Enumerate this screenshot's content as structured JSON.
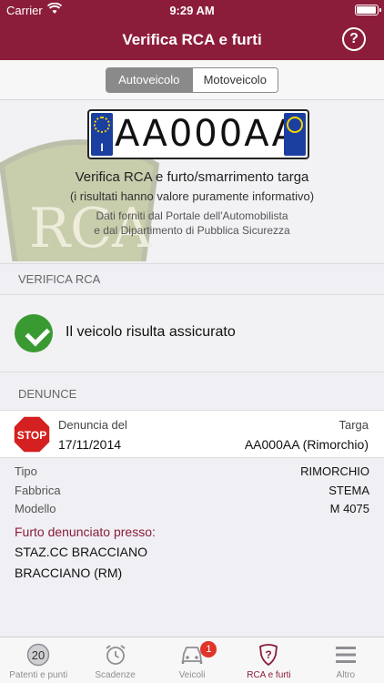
{
  "status_bar": {
    "carrier": "Carrier",
    "time": "9:29 AM"
  },
  "nav": {
    "title": "Verifica RCA e furti"
  },
  "segments": [
    {
      "label": "Autoveicolo",
      "selected": true
    },
    {
      "label": "Motoveicolo",
      "selected": false
    }
  ],
  "plate": {
    "number": "AA000AA",
    "country_letter": "I"
  },
  "shield_text": "RCA",
  "header_text": {
    "line1": "Verifica RCA e furto/smarrimento targa",
    "line2": "(i risultati hanno valore puramente informativo)",
    "line3": "Dati forniti dal Portale dell'Automobilista",
    "line4": "e dal Dipartimento di Pubblica Sicurezza"
  },
  "rca": {
    "section_title": "VERIFICA RCA",
    "result": "Il veicolo risulta assicurato"
  },
  "denunce": {
    "section_title": "DENUNCE",
    "label": "Denuncia del",
    "date": "17/11/2014",
    "targa_label": "Targa",
    "targa_value": "AA000AA (Rimorchio)",
    "stop_text": "STOP",
    "details": [
      {
        "key": "Tipo",
        "value": "RIMORCHIO"
      },
      {
        "key": "Fabbrica",
        "value": "STEMA"
      },
      {
        "key": "Modello",
        "value": "M 4075"
      }
    ],
    "furto_title": "Furto denunciato presso:",
    "place_line1": "STAZ.CC BRACCIANO",
    "place_line2": "BRACCIANO (RM)"
  },
  "tabs": [
    {
      "label": "Patenti e punti",
      "icon": "score-circle-icon",
      "icon_text": "20"
    },
    {
      "label": "Scadenze",
      "icon": "alarm-clock-icon",
      "badge": "1"
    },
    {
      "label": "Veicoli",
      "icon": "car-icon"
    },
    {
      "label": "RCA e furti",
      "icon": "shield-question-icon",
      "active": true
    },
    {
      "label": "Altro",
      "icon": "menu-icon"
    }
  ],
  "colors": {
    "brand": "#8b1d3a",
    "success": "#3a9a32",
    "badge": "#e0342a"
  }
}
